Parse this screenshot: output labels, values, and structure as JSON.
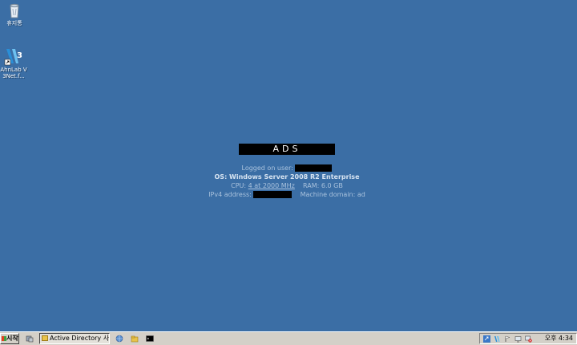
{
  "desktop": {
    "icons": [
      {
        "label": "휴지통",
        "icon": "recycle-bin-icon"
      },
      {
        "label": "AhnLab V3Net.f...",
        "icon": "ahnlab-v3-icon"
      }
    ]
  },
  "bginfo": {
    "hostname": "ADS",
    "logged_on_label": "Logged on user:",
    "os": "OS: Windows Server 2008 R2 Enterprise",
    "cpu_label": "CPU:",
    "cpu_value": "4 at 2000 MHz",
    "ram": "RAM: 6.0 GB",
    "ipv4_label": "IPv4 address:",
    "domain": "Machine domain: ad"
  },
  "taskbar": {
    "start_label": "시작",
    "window_button": "Active Directory 사용...",
    "clock": "오후 4:34"
  },
  "colors": {
    "desktop": "#3b6ea5",
    "taskbar": "#d4d0c8"
  }
}
